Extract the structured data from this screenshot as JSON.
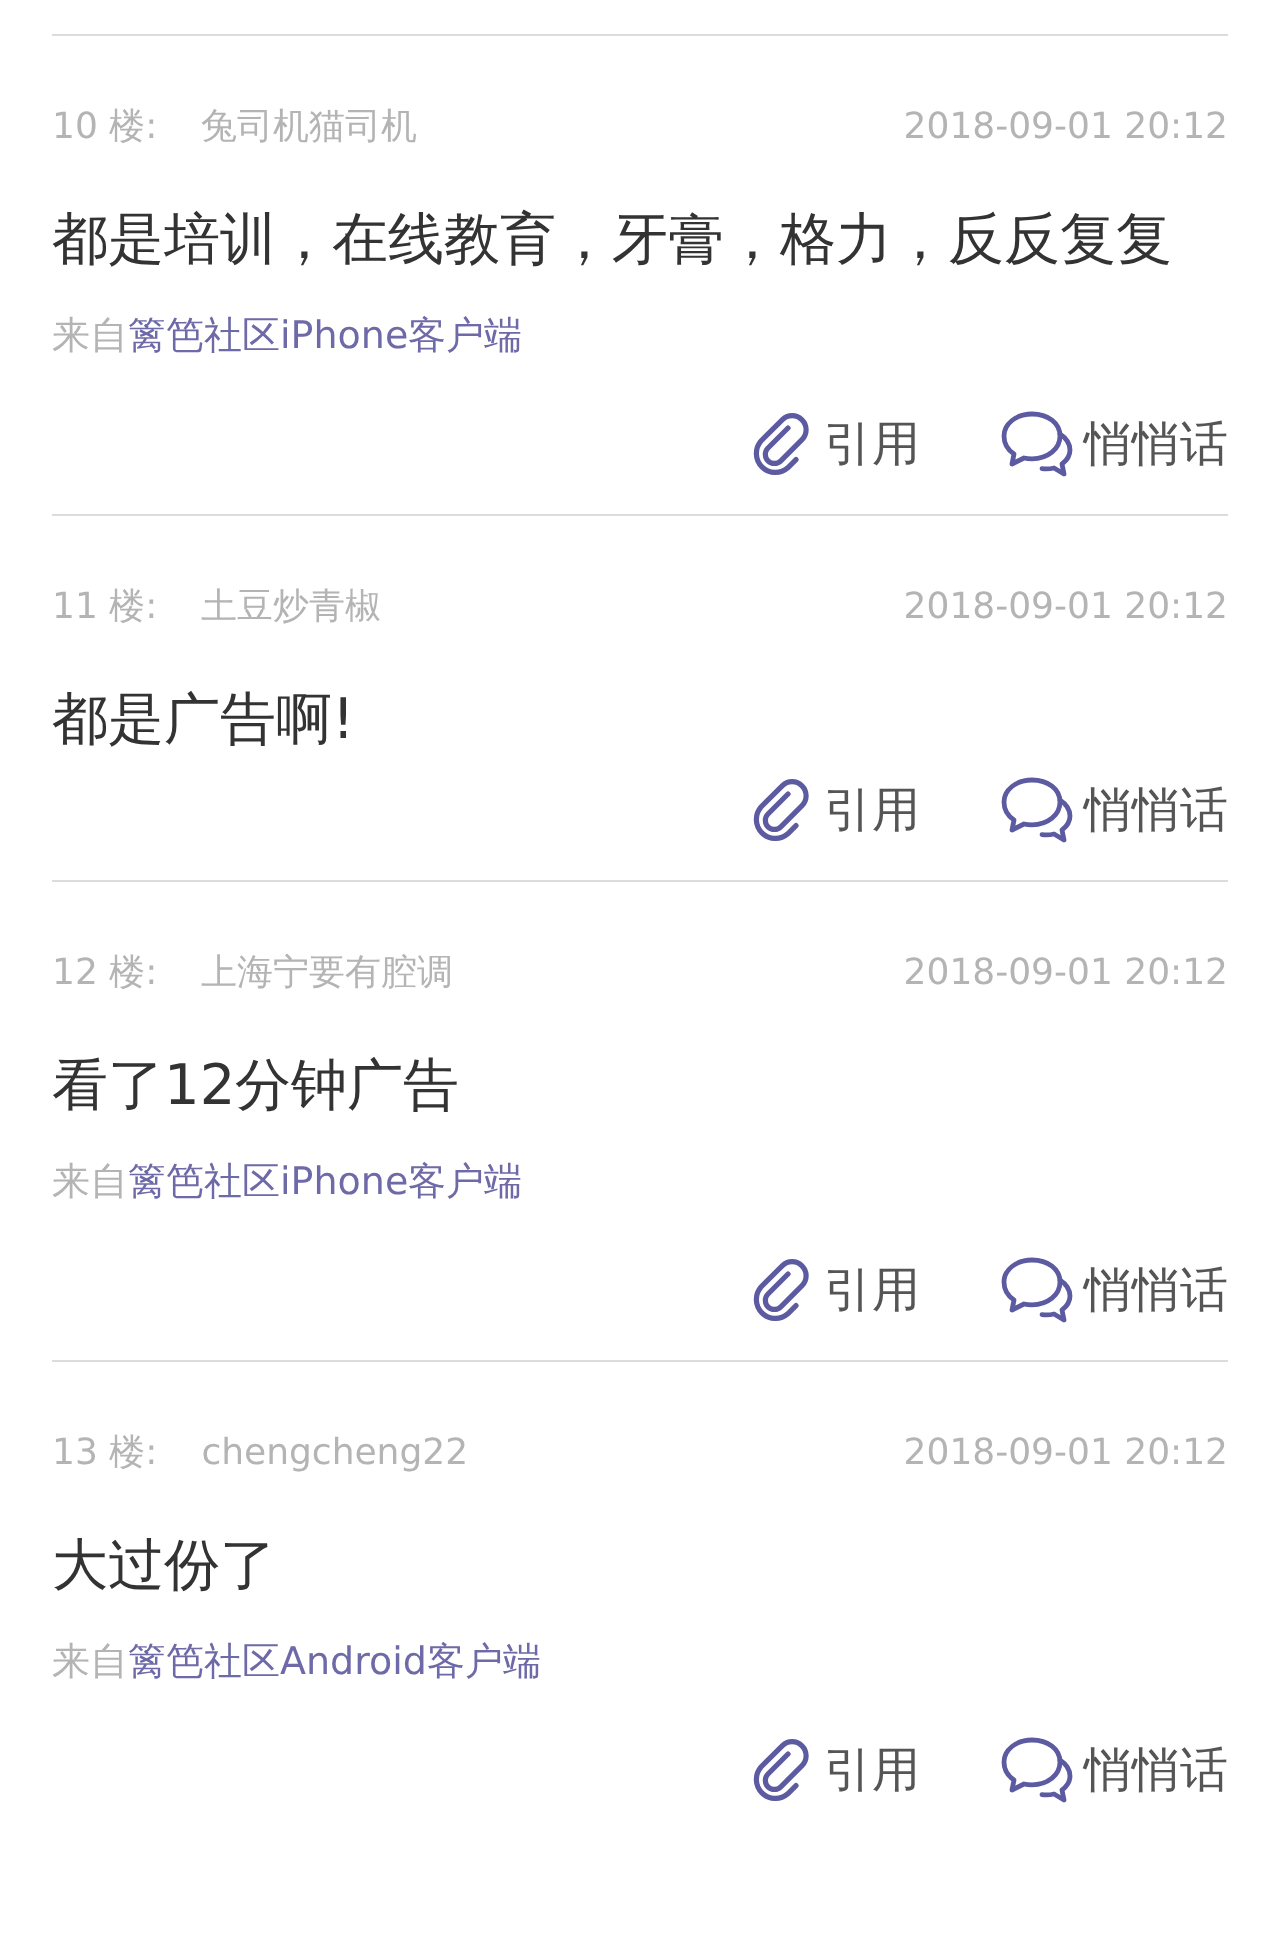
{
  "posts": [
    {
      "floor": "10 楼:",
      "author": "兔司机猫司机",
      "time": "2018-09-01 20:12",
      "content": "都是培训，在线教育，牙膏，格力，反反复复",
      "source": {
        "prefix": "来自",
        "app": "篱笆社区iPhone客户端"
      },
      "actions": [
        "引用",
        "悄悄话"
      ]
    },
    {
      "floor": "11 楼:",
      "author": "土豆炒青椒",
      "time": "2018-09-01 20:12",
      "content": "都是广告啊!",
      "actions": [
        "引用",
        "悄悄话"
      ]
    },
    {
      "floor": "12 楼:",
      "author": "上海宁要有腔调",
      "time": "2018-09-01 20:12",
      "content": "看了12分钟广告",
      "source": {
        "prefix": "来自",
        "app": "篱笆社区iPhone客户端"
      },
      "actions": [
        "引用",
        "悄悄话"
      ]
    },
    {
      "floor": "13 楼:",
      "author": "chengcheng22",
      "time": "2018-09-01 20:12",
      "content": "大过份了",
      "source": {
        "prefix": "来自",
        "app": "篱笆社区Android客户端"
      },
      "actions": [
        "引用",
        "悄悄话"
      ]
    }
  ]
}
